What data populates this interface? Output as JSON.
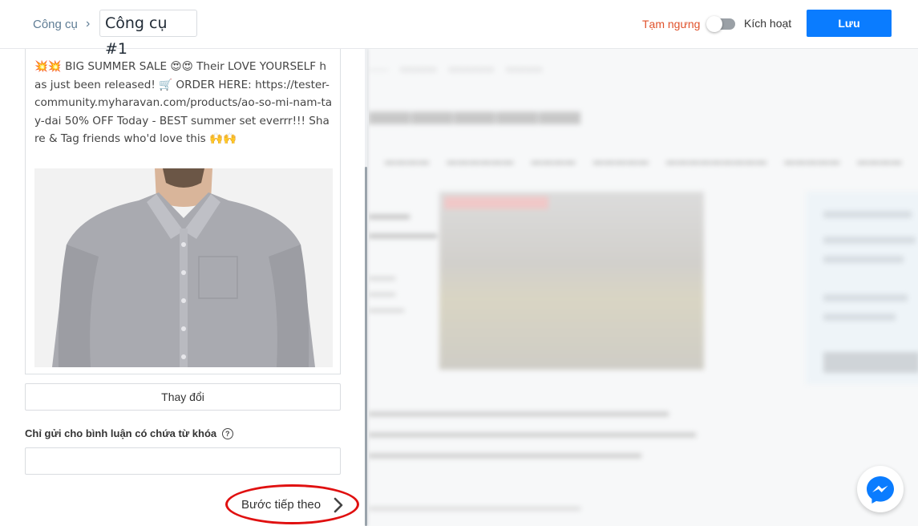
{
  "header": {
    "breadcrumb_root": "Công cụ",
    "breadcrumb_sep": "›",
    "tool_name": "Công cụ #1",
    "pause_label": "Tạm ngưng",
    "active_label": "Kích hoạt",
    "save_label": "Lưu",
    "toggle_on": false
  },
  "post": {
    "text": "💥💥 BIG SUMMER SALE 😍😍 Their LOVE YOURSELF has just been released! 🛒 ORDER HERE: https://tester-community.myharavan.com/products/ao-so-mi-nam-tay-dai 50% OFF Today - BEST summer set everrr!!! Share & Tag friends who'd love this 🙌🙌",
    "image_alt": "grey long-sleeve men's shirt"
  },
  "form": {
    "change_label": "Thay đổi",
    "keyword_label": "Chỉ gửi cho bình luận có chứa từ khóa",
    "keyword_value": "",
    "next_label": "Bước tiếp theo"
  },
  "colors": {
    "accent": "#0a7cff",
    "pause": "#e0522b",
    "annotation": "#e01010"
  },
  "icons": {
    "help": "help-circle-icon",
    "next": "chevron-right-icon",
    "messenger": "messenger-icon"
  }
}
